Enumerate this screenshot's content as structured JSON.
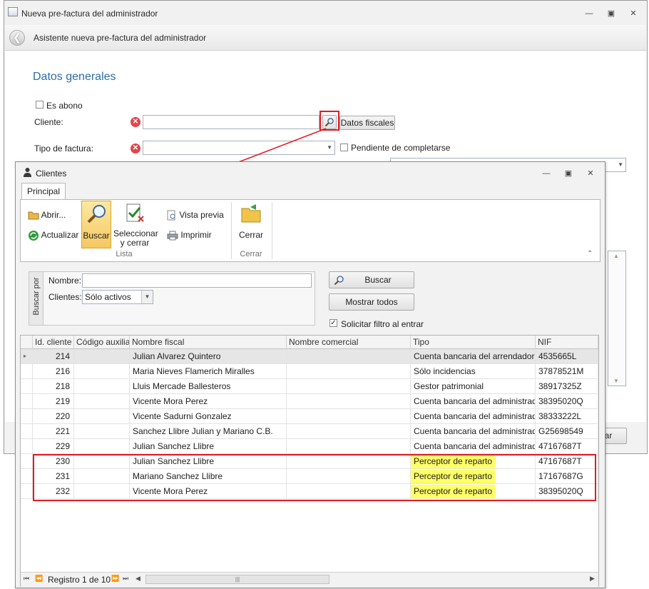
{
  "background_window": {
    "title": "Nueva pre-factura del administrador",
    "wizard_title": "Asistente nueva pre-factura del administrador",
    "section_title": "Datos generales",
    "es_abono_label": "Es abono",
    "cliente_label": "Cliente:",
    "cliente_value": "",
    "datos_fiscales_button": "Datos fiscales",
    "tipo_factura_label": "Tipo de factura:",
    "tipo_factura_value": "",
    "pendiente_label": "Pendiente de completarse",
    "partial_button_label": "lar"
  },
  "clientes_dialog": {
    "title": "Clientes",
    "tabs": [
      "Principal"
    ],
    "ribbon": {
      "abrir": "Abrir...",
      "actualizar": "Actualizar",
      "buscar": "Buscar",
      "seleccionar_line1": "Seleccionar",
      "seleccionar_line2": "y cerrar",
      "vista_previa": "Vista previa",
      "imprimir": "Imprimir",
      "cerrar": "Cerrar",
      "group_lista": "Lista",
      "group_cerrar": "Cerrar"
    },
    "search": {
      "side_label": "Buscar por",
      "nombre_label": "Nombre:",
      "nombre_value": "",
      "clientes_label": "Clientes:",
      "clientes_value": "Sólo activos",
      "buscar_button": "Buscar",
      "mostrar_todos_button": "Mostrar todos",
      "solicitar_filtro_label": "Solicitar filtro al entrar",
      "solicitar_filtro_checked": true
    },
    "grid": {
      "columns": [
        "Id. cliente",
        "Código auxiliar",
        "Nombre fiscal",
        "Nombre comercial",
        "Tipo",
        "NIF"
      ],
      "rows": [
        {
          "id": "214",
          "aux": "",
          "nombre": "Julian Alvarez Quintero",
          "comercial": "",
          "tipo": "Cuenta bancaria del arrendador",
          "nif": "4535665L"
        },
        {
          "id": "216",
          "aux": "",
          "nombre": "Maria Nieves Flamerich Miralles",
          "comercial": "",
          "tipo": "Sólo incidencias",
          "nif": "37878521M"
        },
        {
          "id": "218",
          "aux": "",
          "nombre": "Lluis Mercade Ballesteros",
          "comercial": "",
          "tipo": "Gestor patrimonial",
          "nif": "38917325Z"
        },
        {
          "id": "219",
          "aux": "",
          "nombre": "Vicente Mora Perez",
          "comercial": "",
          "tipo": "Cuenta bancaria del administrador",
          "nif": "38395020Q"
        },
        {
          "id": "220",
          "aux": "",
          "nombre": "Vicente Sadurni Gonzalez",
          "comercial": "",
          "tipo": "Cuenta bancaria del administrador",
          "nif": "38333222L"
        },
        {
          "id": "221",
          "aux": "",
          "nombre": "Sanchez Llibre Julian y Mariano C.B.",
          "comercial": "",
          "tipo": "Cuenta bancaria del administrador",
          "nif": "G25698549"
        },
        {
          "id": "229",
          "aux": "",
          "nombre": "Julian Sanchez Llibre",
          "comercial": "",
          "tipo": "Cuenta bancaria del administrador",
          "nif": "47167687T"
        },
        {
          "id": "230",
          "aux": "",
          "nombre": "Julian Sanchez Llibre",
          "comercial": "",
          "tipo": "Perceptor de reparto",
          "nif": "47167687T"
        },
        {
          "id": "231",
          "aux": "",
          "nombre": "Mariano Sanchez Llibre",
          "comercial": "",
          "tipo": "Perceptor de reparto",
          "nif": "17167687G"
        },
        {
          "id": "232",
          "aux": "",
          "nombre": "Vicente Mora Perez",
          "comercial": "",
          "tipo": "Perceptor de reparto",
          "nif": "38395020Q"
        }
      ],
      "highlight_color": "#ffff66",
      "record_label": "Registro 1 de 10"
    }
  },
  "annotation_color": "#e01b24"
}
